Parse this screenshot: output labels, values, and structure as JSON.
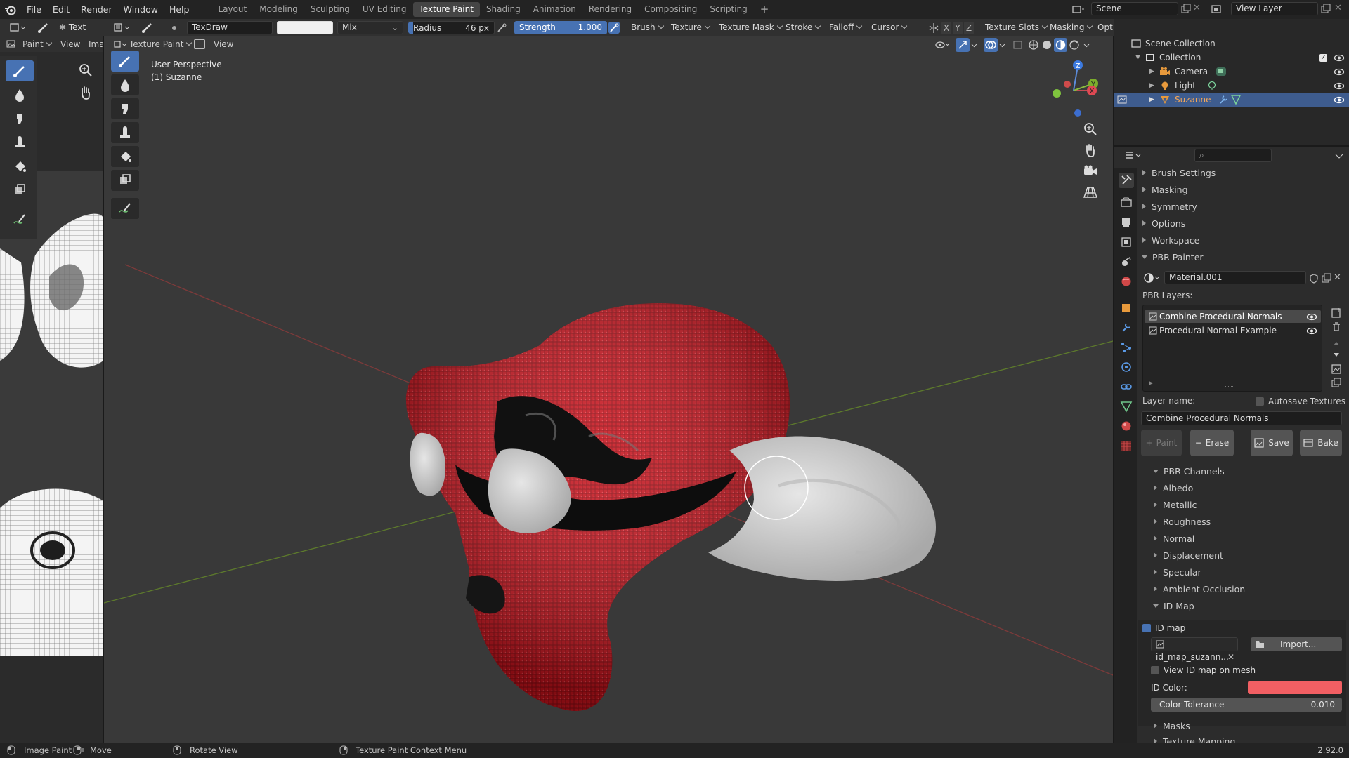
{
  "menubar": {
    "items": [
      "File",
      "Edit",
      "Render",
      "Window",
      "Help"
    ],
    "workspaces": [
      "Layout",
      "Modeling",
      "Sculpting",
      "UV Editing",
      "Texture Paint",
      "Shading",
      "Animation",
      "Rendering",
      "Compositing",
      "Scripting"
    ],
    "active_workspace": "Texture Paint",
    "scene": "Scene",
    "view_layer": "View Layer"
  },
  "header": {
    "left_mode_short": "Text",
    "brush_name": "TexDraw",
    "blend_mode": "Mix",
    "radius_label": "Radius",
    "radius_value": "46 px",
    "strength_label": "Strength",
    "strength_value": "1.000",
    "menus": [
      "Brush",
      "Texture",
      "Texture Mask",
      "Stroke",
      "Falloff",
      "Cursor"
    ],
    "axes": [
      "X",
      "Y",
      "Z"
    ],
    "right_menus": [
      "Texture Slots",
      "Masking",
      "Opt"
    ]
  },
  "image_editor": {
    "mode": "Paint",
    "view": "View",
    "image_menu": "Imag"
  },
  "viewport": {
    "mode": "Texture Paint",
    "view": "View",
    "perspective": "User Perspective",
    "object": "(1) Suzanne",
    "colors": {
      "paint": "#c8121c",
      "bg": "#393939"
    }
  },
  "outliner": {
    "root": "Scene Collection",
    "collection": "Collection",
    "items": [
      "Camera",
      "Light",
      "Suzanne"
    ],
    "selected": "Suzanne"
  },
  "properties": {
    "sections": [
      "Brush Settings",
      "Masking",
      "Symmetry",
      "Options",
      "Workspace",
      "PBR Painter"
    ],
    "material": "Material.001",
    "pbr_layers_label": "PBR Layers:",
    "layers": [
      "Combine Procedural Normals",
      "Procedural Normal Example"
    ],
    "layer_name_label": "Layer name:",
    "autosave_label": "Autosave Textures",
    "layer_name_value": "Combine Procedural Normals",
    "buttons": {
      "paint": "Paint",
      "erase": "Erase",
      "save": "Save",
      "bake": "Bake"
    },
    "pbr_channels": "PBR Channels",
    "channels": [
      "Albedo",
      "Metallic",
      "Roughness",
      "Normal",
      "Displacement",
      "Specular",
      "Ambient Occlusion"
    ],
    "id_map_section": "ID Map",
    "id_map_checkbox": "ID map",
    "id_map_file": "id_map_suzann...",
    "import_label": "Import...",
    "view_id_map": "View ID map on mesh",
    "id_color_label": "ID Color:",
    "id_color": "#f25f63",
    "tolerance_label": "Color Tolerance",
    "tolerance_value": "0.010",
    "masks": "Masks",
    "texture_mapping": "Texture Mapping"
  },
  "statusbar": {
    "items": [
      "Image Paint",
      "Move",
      "Rotate View",
      "Texture Paint Context Menu"
    ],
    "version": "2.92.0"
  }
}
